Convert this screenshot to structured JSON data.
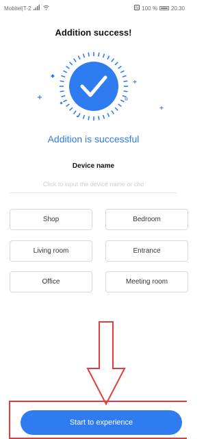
{
  "status_bar": {
    "carrier": "Mobitel|T-2",
    "battery": "100 %",
    "time": "20:30"
  },
  "header": {
    "title": "Addition success!"
  },
  "success": {
    "message": "Addition is successful",
    "accent_color": "#2f7cf0",
    "icon": "check-circle-icon"
  },
  "device_name": {
    "label": "Device name",
    "placeholder": "Click to input the device name or cho",
    "value": ""
  },
  "name_options": [
    "Shop",
    "Bedroom",
    "Living room",
    "Entrance",
    "Office",
    "Meeting room"
  ],
  "annotation": {
    "arrow": "down-arrow-icon",
    "color": "#e23b3b"
  },
  "footer": {
    "start_label": "Start to experience"
  }
}
